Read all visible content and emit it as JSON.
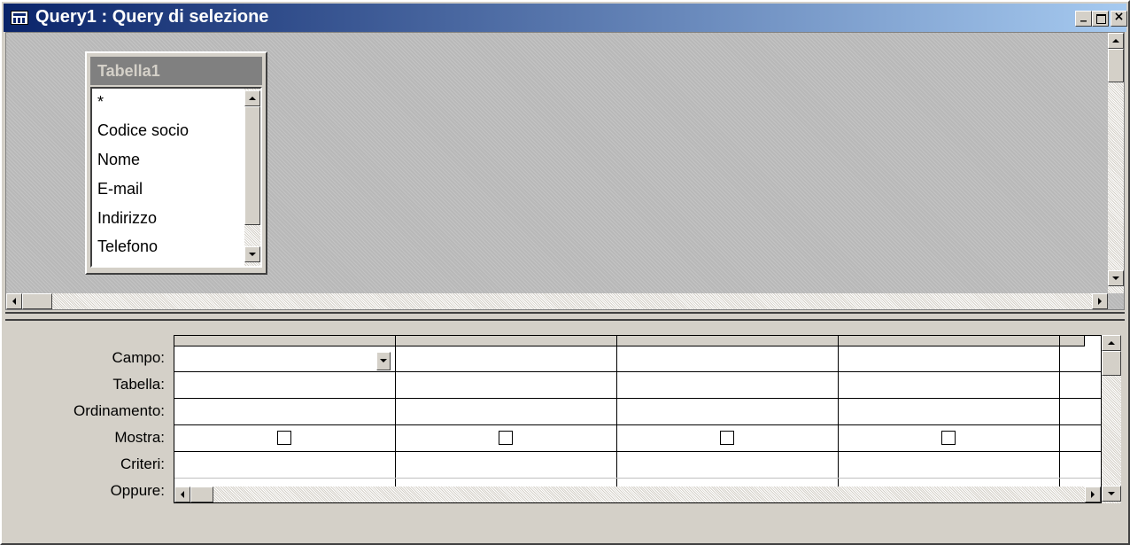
{
  "window": {
    "title": "Query1 : Query di selezione",
    "icon": "query-icon",
    "controls": [
      "minimize-icon",
      "maximize-icon",
      "close-icon"
    ]
  },
  "table": {
    "title": "Tabella1",
    "fields": [
      "*",
      "Codice socio",
      "Nome",
      "E-mail",
      "Indirizzo",
      "Telefono"
    ]
  },
  "grid": {
    "row_labels": [
      "Campo:",
      "Tabella:",
      "Ordinamento:",
      "Mostra:",
      "Criteri:",
      "Oppure:"
    ],
    "column_count": 5,
    "show_checked": [
      false,
      false,
      false,
      false
    ]
  },
  "colors": {
    "titlebar_start": "#0a246a",
    "titlebar_end": "#a6caf0",
    "face": "#d4d0c8"
  }
}
